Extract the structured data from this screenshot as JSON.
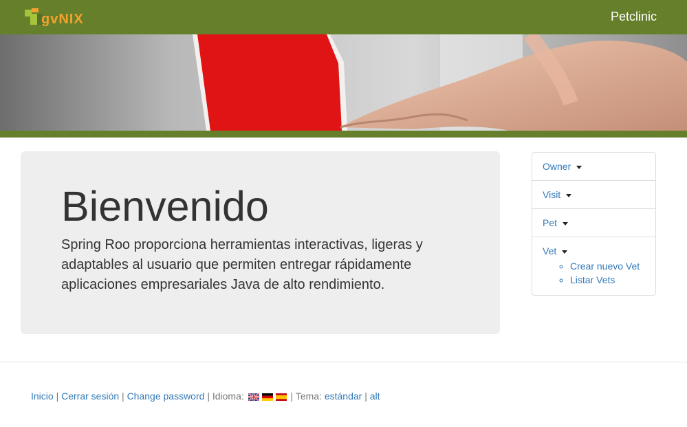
{
  "header": {
    "logo_text": "gvNIX",
    "app_title": "Petclinic"
  },
  "main": {
    "heading": "Bienvenido",
    "description": "Spring Roo proporciona herramientas interactivas, ligeras y adaptables al usuario que permiten entregar rápidamente aplicaciones empresariales Java de alto rendimiento."
  },
  "menu": {
    "items": [
      {
        "label": "Owner"
      },
      {
        "label": "Visit"
      },
      {
        "label": "Pet"
      },
      {
        "label": "Vet",
        "children": [
          "Crear nuevo Vet",
          "Listar Vets"
        ]
      }
    ]
  },
  "footer": {
    "home": "Inicio",
    "logout": "Cerrar sesión",
    "change_password": "Change password",
    "language_label": "Idioma:",
    "theme_label": "Tema:",
    "theme_standard": "estándar",
    "theme_alt": "alt",
    "separator": "|"
  },
  "colors": {
    "header_green": "#667f2a",
    "link_blue": "#337ab7",
    "logo_orange": "#f2a22d"
  }
}
